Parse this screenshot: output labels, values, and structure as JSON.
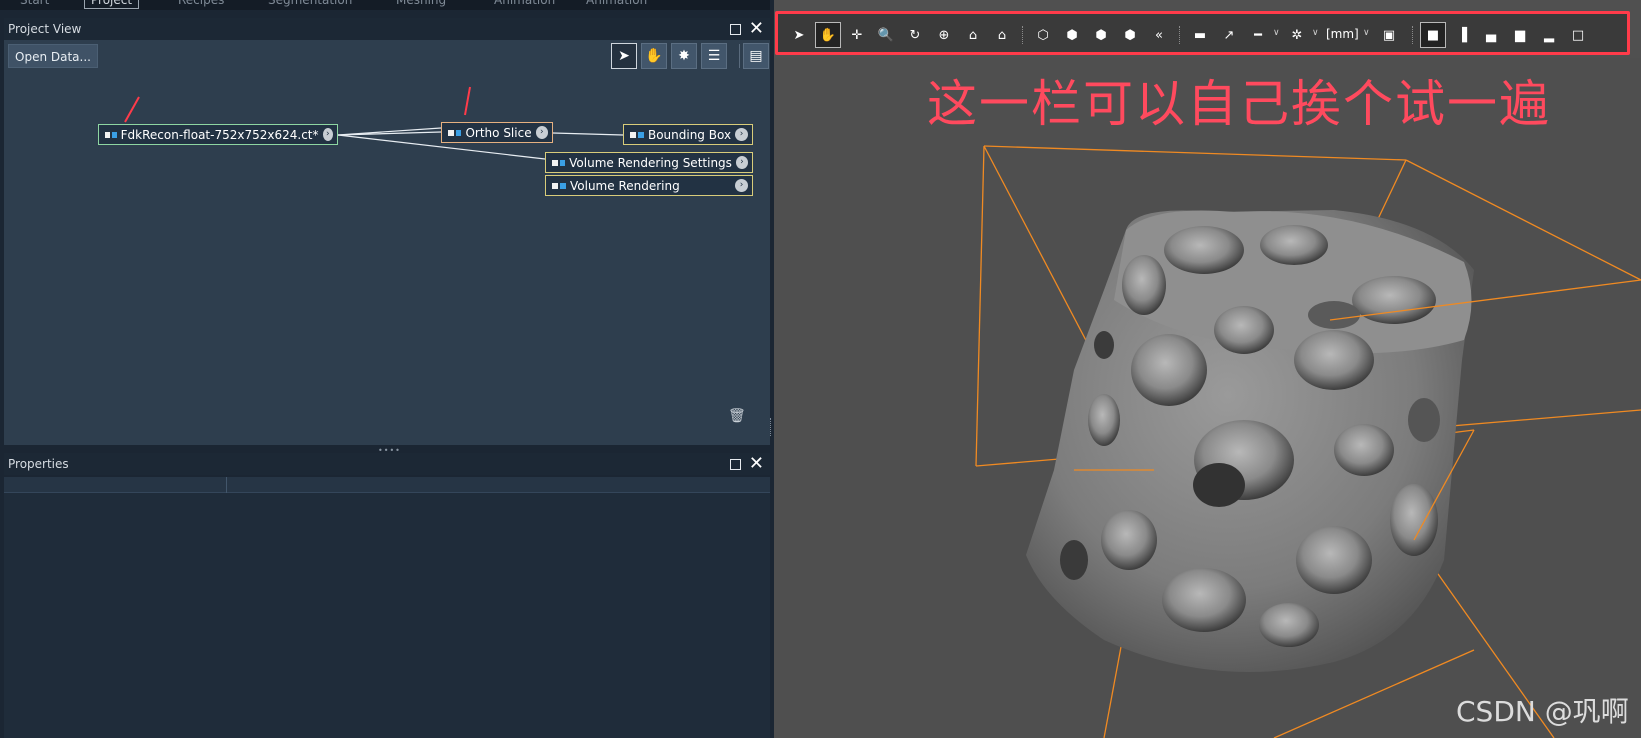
{
  "top_tabs": [
    "Start",
    "Project",
    "Recipes",
    "Segmentation",
    "Meshing",
    "Animation",
    "Animation"
  ],
  "project_view": {
    "title": "Project View",
    "open_data_label": "Open Data...",
    "tools": [
      "pointer-icon",
      "hand-icon",
      "auto-layout-icon",
      "tree-view-icon",
      "panel-toggle-icon"
    ],
    "nodes": {
      "data": "FdkRecon-float-752x752x624.ct*",
      "ortho": "Ortho Slice",
      "bbox": "Bounding Box",
      "vr_settings": "Volume Rendering Settings",
      "vr": "Volume Rendering"
    }
  },
  "properties": {
    "title": "Properties"
  },
  "viewer": {
    "toolbar_unit": "[mm]",
    "toolbar_icons": [
      "select-icon",
      "pan-hand-icon",
      "translate-icon",
      "zoom-icon",
      "rotate-icon",
      "center-icon",
      "home-icon",
      "set-home-icon",
      "view-x-icon",
      "view-y-icon",
      "view-z-icon",
      "view-persp-icon",
      "seek-icon",
      "perspective-icon",
      "measure-tool-icon",
      "ruler-icon",
      "transform-icon",
      "screenshot-icon",
      "layout-single-icon",
      "layout-vsplit-icon",
      "layout-hsplit-icon",
      "layout-quad-icon",
      "layout-stack-icon",
      "layout-fullscreen-icon"
    ],
    "annotation": "这一栏可以自己挨个试一遍",
    "watermark": "CSDN @巩啊"
  },
  "colors": {
    "highlight_red": "#ff3b4a",
    "bbox_orange": "#f08a22",
    "node_data_border": "#8ed6a2",
    "node_ortho_border": "#e5b080",
    "node_default_border": "#d8cc7a"
  }
}
